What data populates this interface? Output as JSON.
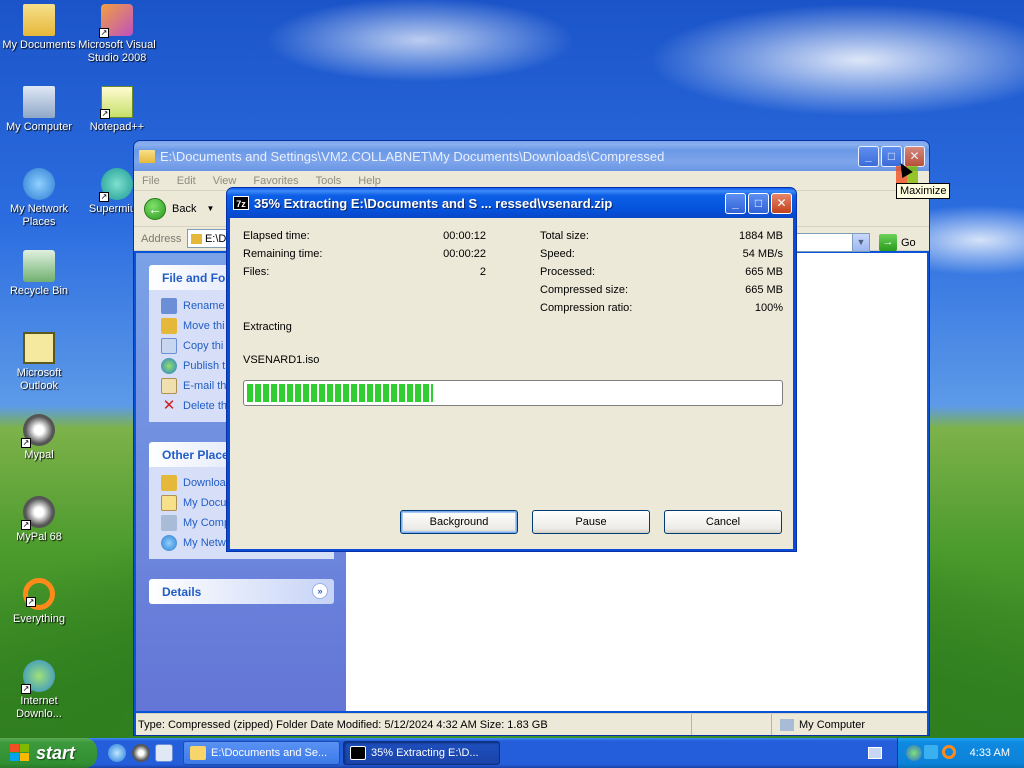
{
  "desktop": {
    "icons": [
      {
        "label": "My Documents"
      },
      {
        "label": "Microsoft Visual Studio 2008"
      },
      {
        "label": "My Computer"
      },
      {
        "label": "Notepad++"
      },
      {
        "label": "My Network Places"
      },
      {
        "label": "Supermium"
      },
      {
        "label": "Recycle Bin"
      },
      {
        "label": "Microsoft Outlook"
      },
      {
        "label": "Mypal"
      },
      {
        "label": "MyPal 68"
      },
      {
        "label": "Everything"
      },
      {
        "label": "Internet Downlo..."
      }
    ]
  },
  "explorer": {
    "title": "E:\\Documents and Settings\\VM2.COLLABNET\\My Documents\\Downloads\\Compressed",
    "menu": [
      "File",
      "Edit",
      "View",
      "Favorites",
      "Tools",
      "Help"
    ],
    "back_label": "Back",
    "address_label": "Address",
    "address_value": "E:\\D",
    "go_label": "Go",
    "file_tasks": {
      "header": "File and Fol",
      "items": [
        "Rename",
        "Move thi",
        "Copy thi",
        "Publish t",
        "E-mail th",
        "Delete th"
      ]
    },
    "other_places": {
      "header": "Other Place",
      "items": [
        "Downloa",
        "My Docu",
        "My Comp",
        "My Netw"
      ]
    },
    "details": {
      "header": "Details"
    },
    "status": {
      "info": "Type: Compressed (zipped) Folder Date Modified: 5/12/2024 4:32 AM Size: 1.83 GB",
      "location": "My Computer"
    },
    "tooltip": "Maximize"
  },
  "dialog": {
    "title": "35% Extracting E:\\Documents and S ... ressed\\vsenard.zip",
    "logo": "7z",
    "stats_left": [
      {
        "label": "Elapsed time:",
        "value": "00:00:12"
      },
      {
        "label": "Remaining time:",
        "value": "00:00:22"
      },
      {
        "label": "Files:",
        "value": "2"
      }
    ],
    "stats_right": [
      {
        "label": "Total size:",
        "value": "1884 MB"
      },
      {
        "label": "Speed:",
        "value": "54 MB/s"
      },
      {
        "label": "Processed:",
        "value": "665 MB"
      },
      {
        "label": "Compressed size:",
        "value": "665 MB"
      },
      {
        "label": "Compression ratio:",
        "value": "100%"
      }
    ],
    "operation": "Extracting",
    "current_file": "VSENARD1.iso",
    "progress_fraction": 0.35,
    "buttons": {
      "background": "Background",
      "pause": "Pause",
      "cancel": "Cancel"
    }
  },
  "taskbar": {
    "start_label": "start",
    "tasks": [
      {
        "label": "E:\\Documents and Se..."
      },
      {
        "label": "35% Extracting E:\\D..."
      }
    ],
    "clock": "4:33 AM"
  }
}
